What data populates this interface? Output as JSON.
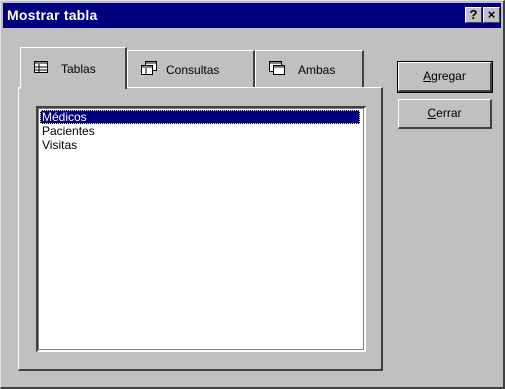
{
  "window": {
    "title": "Mostrar tabla",
    "help_label": "?",
    "close_label": "×"
  },
  "tabs": [
    {
      "label": "Tablas",
      "icon": "table-icon",
      "active": true
    },
    {
      "label": "Consultas",
      "icon": "query-icon",
      "active": false
    },
    {
      "label": "Ambas",
      "icon": "both-icon",
      "active": false
    }
  ],
  "list": {
    "items": [
      "Médicos",
      "Pacientes",
      "Visitas"
    ],
    "selected_index": 0
  },
  "buttons": {
    "add": {
      "mnemonic": "A",
      "rest": "gregar"
    },
    "close": {
      "mnemonic": "C",
      "rest": "errar"
    }
  },
  "colors": {
    "titlebar": "#00007e",
    "face": "#c0c0c0",
    "selection": "#00007e"
  }
}
